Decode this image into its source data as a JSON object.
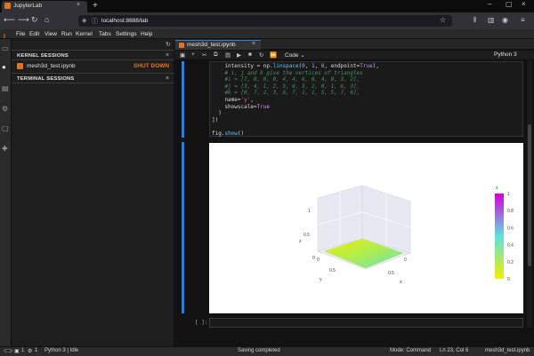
{
  "browser": {
    "tab_title": "JupyterLab",
    "tab_close": "×",
    "new_tab": "+",
    "url": "localhost:8888/lab",
    "window_controls": [
      "–",
      "▢",
      "×"
    ]
  },
  "menu": {
    "items": [
      "File",
      "Edit",
      "View",
      "Run",
      "Kernel",
      "Tabs",
      "Settings",
      "Help"
    ]
  },
  "sidebar": {
    "kernel_sessions_title": "KERNEL SESSIONS",
    "kernel_session_name": "mesh3d_test.ipynb",
    "shutdown_label": "SHUT DOWN",
    "terminal_sessions_title": "TERMINAL SESSIONS",
    "close_glyph": "×"
  },
  "notebook": {
    "tab_title": "mesh3d_test.ipynb",
    "tab_close": "×",
    "cell_type": "Code",
    "kernel_label": "Python 3",
    "empty_prompt": "[ ]:"
  },
  "code_lines": [
    {
      "segments": [
        {
          "t": "    intensity = np.",
          "c": ""
        },
        {
          "t": "linspace",
          "c": "fn"
        },
        {
          "t": "(",
          "c": ""
        },
        {
          "t": "0",
          "c": "num"
        },
        {
          "t": ", ",
          "c": ""
        },
        {
          "t": "1",
          "c": "num"
        },
        {
          "t": ", ",
          "c": ""
        },
        {
          "t": "8",
          "c": "num"
        },
        {
          "t": ", endpoint=",
          "c": ""
        },
        {
          "t": "True",
          "c": "kw"
        },
        {
          "t": "),",
          "c": ""
        }
      ]
    },
    {
      "segments": [
        {
          "t": "    # i, j and k give the vertices of triangles",
          "c": "cm"
        }
      ]
    },
    {
      "segments": [
        {
          "t": "    #i = [7, 0, 0, 0, 4, 4, 6, 6, 4, 0, 3, 2],",
          "c": "cm"
        }
      ]
    },
    {
      "segments": [
        {
          "t": "    #j = [3, 4, 1, 2, 5, 6, 5, 2, 0, 1, 6, 3],",
          "c": "cm"
        }
      ]
    },
    {
      "segments": [
        {
          "t": "    #k = [0, 7, 2, 3, 6, 7, 1, 1, 5, 5, 7, 6],",
          "c": "cm"
        }
      ]
    },
    {
      "segments": [
        {
          "t": "    name=",
          "c": ""
        },
        {
          "t": "'y'",
          "c": "str"
        },
        {
          "t": ",",
          "c": ""
        }
      ]
    },
    {
      "segments": [
        {
          "t": "    showscale=",
          "c": ""
        },
        {
          "t": "True",
          "c": "kw"
        }
      ]
    },
    {
      "segments": [
        {
          "t": "  )",
          "c": ""
        }
      ]
    },
    {
      "segments": [
        {
          "t": "])",
          "c": ""
        }
      ]
    },
    {
      "segments": [
        {
          "t": "",
          "c": ""
        }
      ]
    },
    {
      "segments": [
        {
          "t": "fig.",
          "c": ""
        },
        {
          "t": "show",
          "c": "fn"
        },
        {
          "t": "()",
          "c": ""
        }
      ]
    }
  ],
  "plot": {
    "axis_labels": {
      "x": "x",
      "y": "y",
      "z": "z"
    },
    "z_tick_top": "1",
    "z_tick_mid": "0.5",
    "z_tick_zero": "0",
    "y_tick_a": "0.5",
    "y_tick_b": "0",
    "x_tick_a": "0",
    "x_tick_b": "0.5",
    "colorbar_title": "z",
    "colorbar_ticks": [
      "1",
      "0.8",
      "0.6",
      "0.4",
      "0.2",
      "0"
    ],
    "colors": {
      "top": "#d400d4",
      "mid": "#60e0e0",
      "bottom": "#f0f000"
    }
  },
  "statusbar": {
    "left_count_a": "1",
    "left_count_b": "1",
    "kernel_status": "Python 3 | Idle",
    "saving": "Saving completed",
    "mode": "Mode: Command",
    "position": "Ln 23, Col 6",
    "filename": "mesh3d_test.ipynb"
  }
}
